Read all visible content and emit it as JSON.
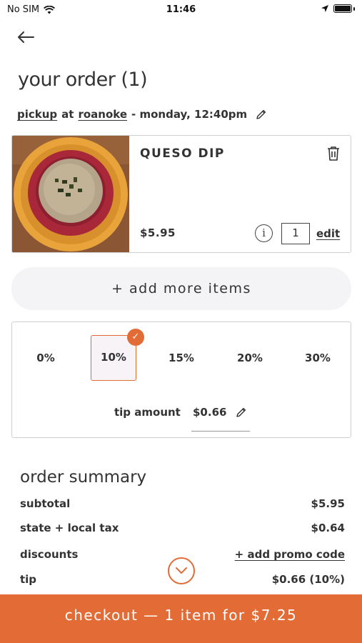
{
  "status_bar": {
    "carrier": "No SIM",
    "time": "11:46"
  },
  "header": {
    "title": "your order (1)"
  },
  "pickup": {
    "mode": "pickup",
    "at": "at",
    "location": "roanoke",
    "when": "- monday, 12:40pm"
  },
  "item": {
    "name": "QUESO DIP",
    "price": "$5.95",
    "info": "i",
    "quantity": "1",
    "edit_label": "edit"
  },
  "add_more_label": "+ add more items",
  "tip": {
    "options": [
      "0%",
      "10%",
      "15%",
      "20%",
      "30%"
    ],
    "selected": "10%",
    "amount_label": "tip amount",
    "amount_value": "$0.66"
  },
  "summary": {
    "title": "order summary",
    "rows": [
      {
        "label": "subtotal",
        "value": "$5.95"
      },
      {
        "label": "state + local tax",
        "value": "$0.64"
      },
      {
        "label": "discounts",
        "value": "+ add promo code"
      },
      {
        "label": "tip",
        "value": "$0.66 (10%)"
      }
    ]
  },
  "checkout_label": "checkout — 1 item for $7.25",
  "colors": {
    "accent": "#e36c36",
    "text": "#333333",
    "border": "#cfcfcf"
  }
}
